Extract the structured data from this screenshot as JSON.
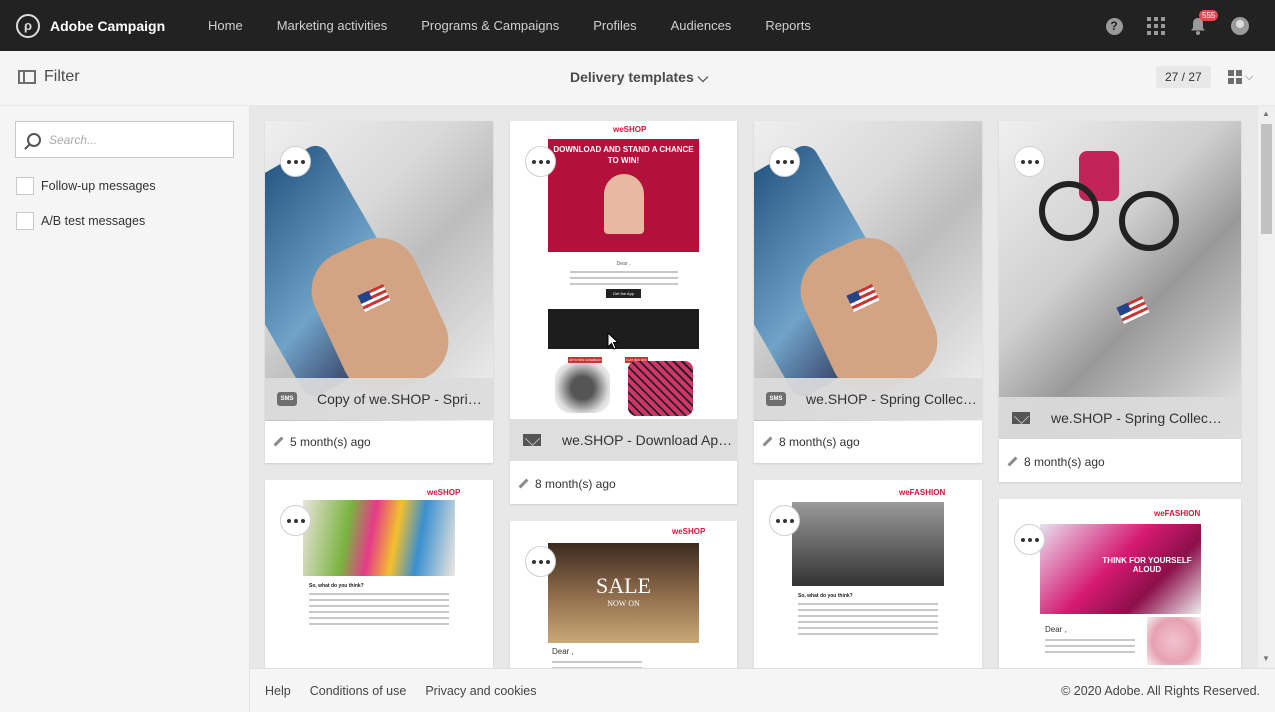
{
  "app": {
    "name": "Adobe Campaign",
    "logo_glyph": "ρ"
  },
  "nav": {
    "items": [
      {
        "label": "Home"
      },
      {
        "label": "Marketing activities"
      },
      {
        "label": "Programs & Campaigns"
      },
      {
        "label": "Profiles"
      },
      {
        "label": "Audiences"
      },
      {
        "label": "Reports"
      }
    ]
  },
  "topbar": {
    "help_glyph": "?",
    "notification_count": "555"
  },
  "subheader": {
    "filter_label": "Filter",
    "view_title": "Delivery templates",
    "view_chevron": "⌵",
    "counter": "27 / 27",
    "layout_chevron": "⌵"
  },
  "sidebar": {
    "search_placeholder": "Search...",
    "checkboxes": [
      {
        "label": "Follow-up messages",
        "checked": false
      },
      {
        "label": "A/B test messages",
        "checked": false
      }
    ]
  },
  "cards": [
    {
      "title": "Copy of we.SHOP - Spring ...",
      "type": "sms",
      "type_label": "SMS",
      "modified": "5 month(s) ago"
    },
    {
      "title": "we.SHOP - Download App ...",
      "type": "email",
      "modified": "8 month(s) ago",
      "preview": {
        "logo": "weSHOP",
        "headline": "DOWNLOAD AND STAND A CHANCE TO WIN!",
        "greeting": "Dear ,",
        "cta": "Get the App",
        "price_tag_1": "UPTO 50% CASHBACK",
        "price_tag_2": "FLAT 30% OFF"
      }
    },
    {
      "title": "we.SHOP - Spring Collectio...",
      "type": "sms",
      "type_label": "SMS",
      "modified": "8 month(s) ago"
    },
    {
      "title": "we.SHOP - Spring Collection ...",
      "type": "email",
      "modified": "8 month(s) ago"
    },
    {
      "preview": {
        "logo": "weSHOP",
        "heading": "So, what do you think?"
      }
    },
    {
      "preview": {
        "logo": "weSHOP",
        "sale_line1": "SALE",
        "sale_line2": "NOW ON",
        "greeting": "Dear ,"
      }
    },
    {
      "preview": {
        "logo": "weFASHION",
        "heading": "So, what do you think?"
      }
    },
    {
      "preview": {
        "logo": "weFASHION",
        "headline": "THINK FOR YOURSELF ALOUD",
        "greeting": "Dear ,"
      }
    }
  ],
  "footer": {
    "links": [
      {
        "label": "Help"
      },
      {
        "label": "Conditions of use"
      },
      {
        "label": "Privacy and cookies"
      }
    ],
    "copyright": "© 2020 Adobe. All Rights Reserved."
  },
  "colors": {
    "topbar": "#222222",
    "accent_red": "#d4143c",
    "background": "#e8e8e8"
  }
}
